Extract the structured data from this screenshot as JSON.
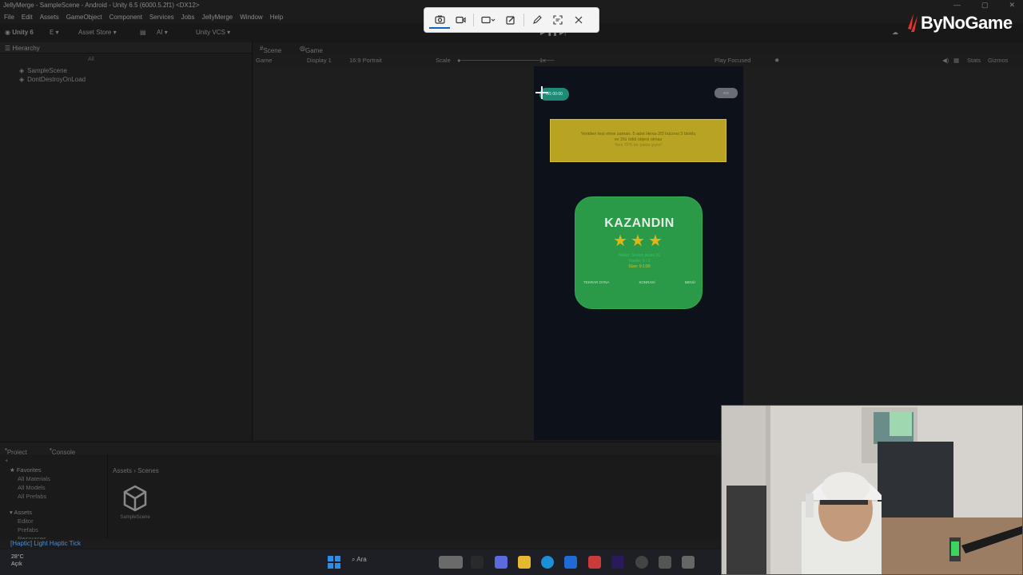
{
  "window": {
    "title": "JellyMerge - SampleScene - Android - Unity 6.5 (6000.5.2f1) <DX12>",
    "controls": [
      "—",
      "▢",
      "✕"
    ]
  },
  "menubar": [
    "File",
    "Edit",
    "Assets",
    "GameObject",
    "Component",
    "Services",
    "Jobs",
    "JellyMerge",
    "Window",
    "Help"
  ],
  "toolbar": {
    "unity": "Unity 6",
    "account": "E ▾",
    "asset_store": "Asset Store ▾",
    "ai": "AI ▾",
    "vcs": "Unity VCS ▾"
  },
  "capture_toolbar": {
    "icons": [
      "camera-icon",
      "video-icon",
      "rectangle-select-icon",
      "edit-image-icon",
      "pen-icon",
      "text-extract-icon",
      "close-icon"
    ]
  },
  "brand": {
    "text": "ByNoGame",
    "accent": "#e8332a"
  },
  "hierarchy": {
    "tab": "Hierarchy",
    "search_placeholder": "All",
    "items": [
      "SampleScene",
      "DontDestroyOnLoad"
    ]
  },
  "game_tabs": {
    "scene": "Scene",
    "game": "Game"
  },
  "game_bar": {
    "mode": "Game",
    "display": "Display 1",
    "aspect": "16:9 Portrait",
    "scale_label": "Scale",
    "scale_value": "1x",
    "play": "Play Focused",
    "stats": "Stats",
    "gizmos": "Gizmos"
  },
  "game": {
    "hud_left": "0/5\n00:00",
    "hud_right": "≡≡≡",
    "notice_line1": "Yeniden test etme zaman. 5 adet Hexa-2f3 hücresi 3 bloklu",
    "notice_line2": "ve 3'lü ödül objesi olmaz",
    "notice_sub": "Yeni TPS ler yakla şıyor!",
    "win_title": "KAZANDIN",
    "stars": "★★★",
    "stats_line1": "Rekor: Seviye puanı 10",
    "stats_line2": "Hamle: 4 / 5",
    "stats_line3": "Süre: 0:1:00",
    "buttons": [
      "TEKRAR OYNA",
      "SONRAKİ",
      "MENÜ"
    ]
  },
  "project": {
    "tabs": {
      "project": "Project",
      "console": "Console"
    },
    "favorites": "Favorites",
    "fav_items": [
      "All Materials",
      "All Models",
      "All Prefabs"
    ],
    "assets": "Assets",
    "asset_folders": [
      "Editor",
      "Prefabs",
      "Resources"
    ],
    "breadcrumb": "Assets  ›  Scenes",
    "file": "SampleScene"
  },
  "status": "[Haptic] Light Haptic Tick",
  "taskbar": {
    "temp": "28°C",
    "weather": "Açık",
    "search": "Ara"
  }
}
